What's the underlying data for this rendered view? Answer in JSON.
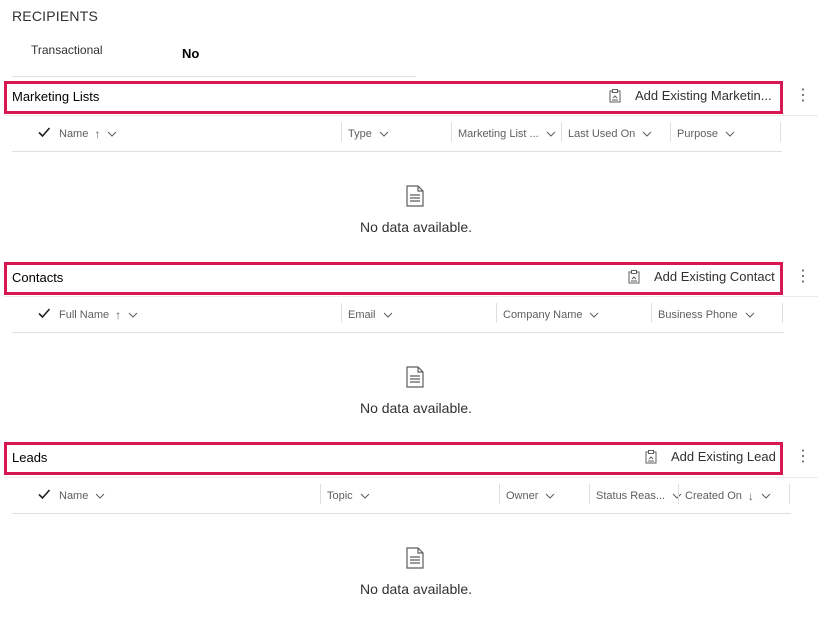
{
  "section": {
    "heading": "RECIPIENTS"
  },
  "fields": [
    {
      "label": "Transactional",
      "value": "No"
    }
  ],
  "grids": [
    {
      "title": "Marketing Lists",
      "command": "Add Existing Marketin...",
      "columns": [
        {
          "label": "Name",
          "sort": "↑"
        },
        {
          "label": "Type"
        },
        {
          "label": "Marketing List ..."
        },
        {
          "label": "Last Used On"
        },
        {
          "label": "Purpose"
        }
      ],
      "empty_text": "No data available."
    },
    {
      "title": "Contacts",
      "command": "Add Existing Contact",
      "columns": [
        {
          "label": "Full Name",
          "sort": "↑"
        },
        {
          "label": "Email"
        },
        {
          "label": "Company Name"
        },
        {
          "label": "Business Phone"
        }
      ],
      "empty_text": "No data available."
    },
    {
      "title": "Leads",
      "command": "Add Existing Lead",
      "columns": [
        {
          "label": "Name"
        },
        {
          "label": "Topic"
        },
        {
          "label": "Owner"
        },
        {
          "label": "Status Reas..."
        },
        {
          "label": "Created On",
          "sort": "↓"
        }
      ],
      "empty_text": "No data available."
    }
  ],
  "icons": {
    "command": "clipboard-add-icon",
    "more": "more-vertical-icon",
    "select_all": "checkmark-icon",
    "empty": "document-icon",
    "column_menu": "chevron-down-icon"
  },
  "colors": {
    "highlight": "#d7174f"
  },
  "more_glyph": "⋮"
}
